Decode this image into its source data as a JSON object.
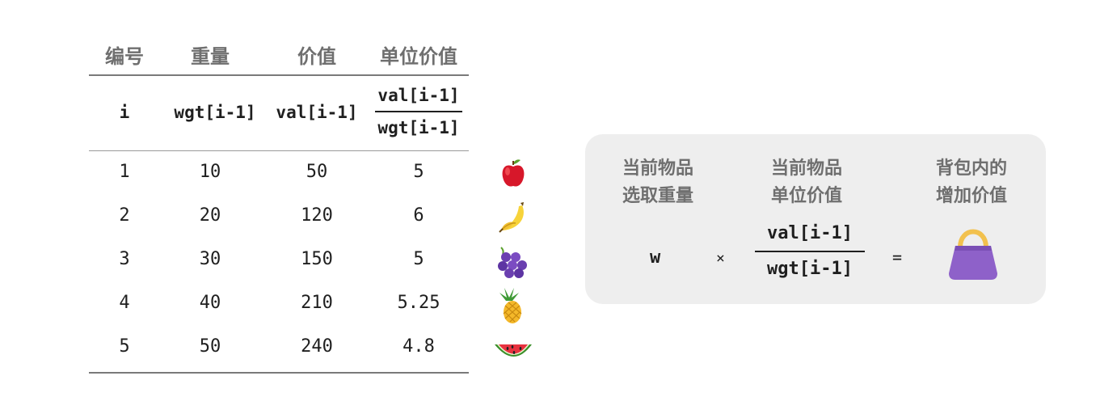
{
  "table": {
    "header_cn": [
      "编号",
      "重量",
      "价值",
      "单位价值"
    ],
    "header_sym": {
      "index": "i",
      "weight": "wgt[i-1]",
      "value": "val[i-1]",
      "unit_num": "val[i-1]",
      "unit_den": "wgt[i-1]"
    },
    "rows": [
      {
        "i": "1",
        "wgt": "10",
        "val": "50",
        "unit": "5",
        "icon": "apple-icon"
      },
      {
        "i": "2",
        "wgt": "20",
        "val": "120",
        "unit": "6",
        "icon": "banana-icon"
      },
      {
        "i": "3",
        "wgt": "30",
        "val": "150",
        "unit": "5",
        "icon": "grapes-icon"
      },
      {
        "i": "4",
        "wgt": "40",
        "val": "210",
        "unit": "5.25",
        "icon": "pineapple-icon"
      },
      {
        "i": "5",
        "wgt": "50",
        "val": "240",
        "unit": "4.8",
        "icon": "watermelon-icon"
      }
    ]
  },
  "formula": {
    "label_weight_line1": "当前物品",
    "label_weight_line2": "选取重量",
    "label_unit_line1": "当前物品",
    "label_unit_line2": "单位价值",
    "label_gain_line1": "背包内的",
    "label_gain_line2": "增加价值",
    "w": "w",
    "times": "×",
    "num": "val[i-1]",
    "den": "wgt[i-1]",
    "equals": "=",
    "icon": "purple-bag-icon"
  },
  "colors": {
    "panel_bg": "#eeeeee",
    "header_text": "#6f6f6f",
    "bag": "#8e61c9",
    "bag_handle": "#f2c14e"
  }
}
